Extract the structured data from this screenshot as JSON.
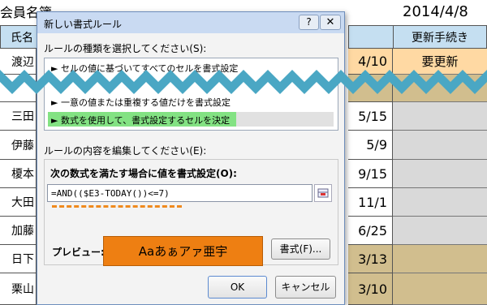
{
  "sheet": {
    "title": "会員名簿",
    "date": "2014/4/8",
    "header_name": "氏名",
    "header_renewal": "更新手続き",
    "rows": [
      {
        "name": "渡辺",
        "date": "4/10",
        "renewal": "要更新"
      },
      {
        "name": "",
        "date": "",
        "renewal": ""
      },
      {
        "name": "三田",
        "date": "5/15",
        "renewal": ""
      },
      {
        "name": "伊藤",
        "date": "5/9",
        "renewal": ""
      },
      {
        "name": "榎本",
        "date": "9/15",
        "renewal": ""
      },
      {
        "name": "大田",
        "date": "11/1",
        "renewal": ""
      },
      {
        "name": "加藤",
        "date": "6/25",
        "renewal": ""
      },
      {
        "name": "日下",
        "date": "3/13",
        "renewal": ""
      },
      {
        "name": "栗山",
        "date": "3/10",
        "renewal": ""
      }
    ]
  },
  "dialog": {
    "title": "新しい書式ルール",
    "help_label": "?",
    "close_label": "✕",
    "rule_type_label": "ルールの種類を選択してください(S):",
    "rule_types": [
      "► セルの値に基づいてすべてのセルを書式設定",
      "► 一意の値または重複する値だけを書式設定",
      "► 数式を使用して、書式設定するセルを決定"
    ],
    "edit_label": "ルールの内容を編集してください(E):",
    "formula_label": "次の数式を満たす場合に値を書式設定(O):",
    "formula_value": "=AND(($E3-TODAY())<=7)",
    "preview_label": "プレビュー:",
    "preview_text": "Aaあぁアァ亜宇",
    "format_button": "書式(F)...",
    "ok_button": "OK",
    "cancel_button": "キャンセル"
  },
  "colors": {
    "selected_rule_highlight": "#83e283",
    "preview_fill": "#ee7f12",
    "zigzag": "#4aa7c4"
  }
}
